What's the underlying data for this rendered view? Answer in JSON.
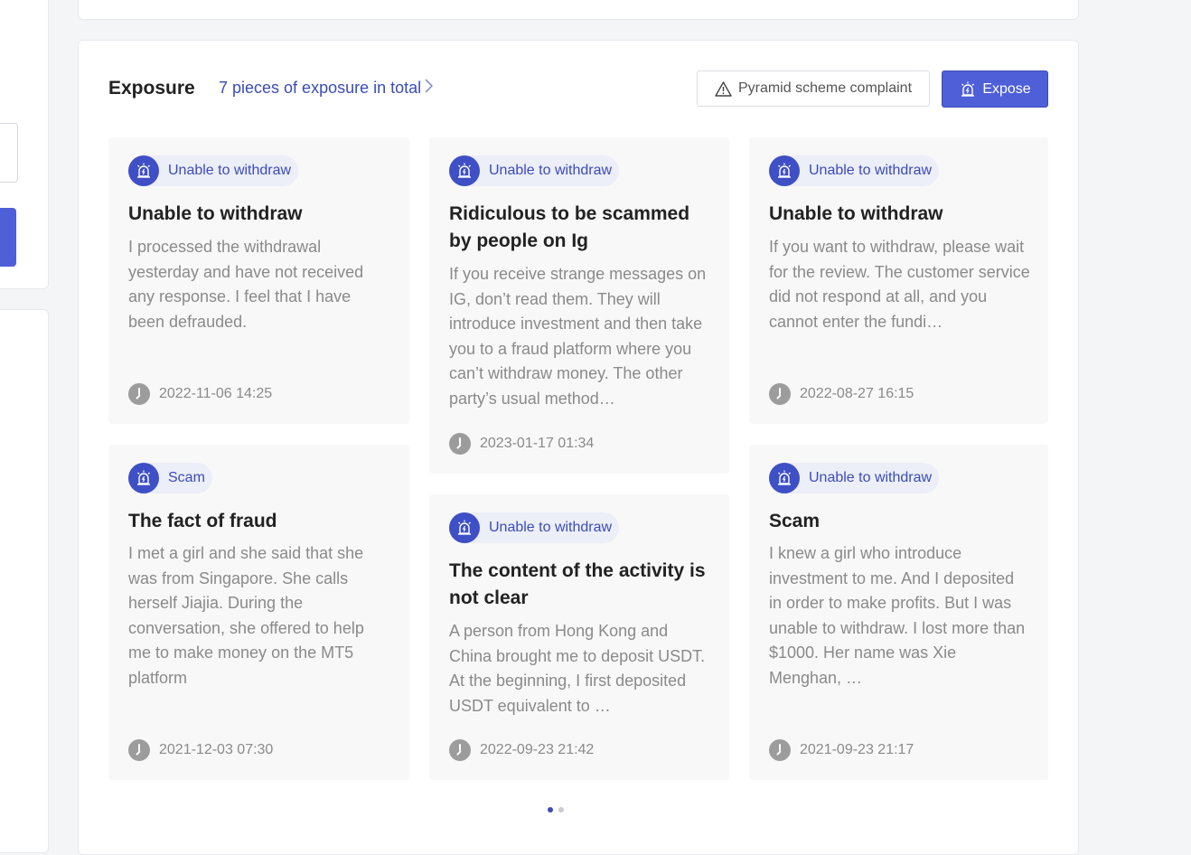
{
  "section": {
    "title": "Exposure",
    "total_link": "7 pieces of exposure in total",
    "complaint_button": "Pyramid scheme complaint",
    "expose_button": "Expose"
  },
  "colors": {
    "accent": "#4f5fd8",
    "tag_text": "#3b4cb8",
    "body_text": "#8a8a8a"
  },
  "cards": [
    {
      "tag": "Unable to withdraw",
      "title": "Unable to withdraw",
      "body": "I processed the withdrawal yesterday and have not received any response. I feel that I have been defrauded.",
      "time": "2022-11-06 14:25"
    },
    {
      "tag": "Unable to withdraw",
      "title": "Ridiculous to be scammed by people on Ig",
      "body": "If you receive strange messages on IG, don’t read them. They will introduce investment and then take you to a fraud platform where you can’t withdraw money. The other party’s usual method…",
      "time": "2023-01-17 01:34"
    },
    {
      "tag": "Unable to withdraw",
      "title": "Unable to withdraw",
      "body": "If you want to withdraw, please wait for the review. The customer service did not respond at all, and you cannot enter the fundi…",
      "time": "2022-08-27 16:15"
    },
    {
      "tag": "Scam",
      "title": "The fact of fraud",
      "body": "I met a girl and she said that she was from Singapore. She calls herself Jiajia. During the conversation, she offered to help me to make money on the MT5 platform",
      "time": "2021-12-03 07:30"
    },
    {
      "tag": "Unable to withdraw",
      "title": "The content of the activity is not clear",
      "body": "A person from Hong Kong and China brought me to deposit USDT. At the beginning, I first deposited USDT equivalent to …",
      "time": "2022-09-23 21:42"
    },
    {
      "tag": "Unable to withdraw",
      "title": "Scam",
      "body": "I knew a girl who introduce investment to me. And I deposited in order to make profits. But I was unable to withdraw. I lost more than $1000. Her name was Xie Menghan, …",
      "time": "2021-09-23 21:17"
    }
  ]
}
